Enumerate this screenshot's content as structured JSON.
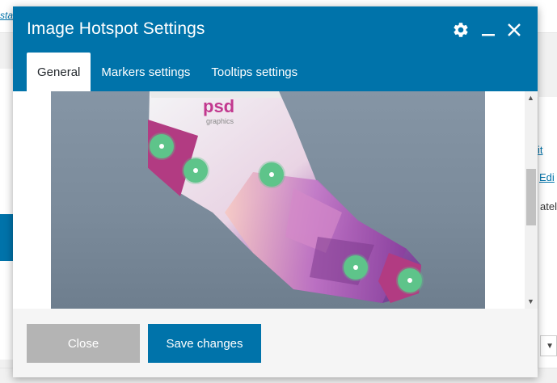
{
  "background": {
    "left_link": "stac",
    "right_link_1": "it",
    "right_link_2": "Edi",
    "right_text": "ately"
  },
  "modal": {
    "title": "Image Hotspot Settings",
    "icons": [
      "gear-icon",
      "minimize-icon",
      "close-icon"
    ],
    "tabs": [
      {
        "label": "General",
        "active": true
      },
      {
        "label": "Markers settings",
        "active": false
      },
      {
        "label": "Tooltips settings",
        "active": false
      }
    ],
    "image": {
      "brand_text": "psd",
      "brand_subtext": "graphics",
      "hotspot_count": 5
    },
    "footer": {
      "close_label": "Close",
      "save_label": "Save changes"
    }
  },
  "colors": {
    "header": "#0073aa",
    "hotspot": "#5ec48a",
    "close_button": "#b4b4b4",
    "save_button": "#0073aa"
  }
}
